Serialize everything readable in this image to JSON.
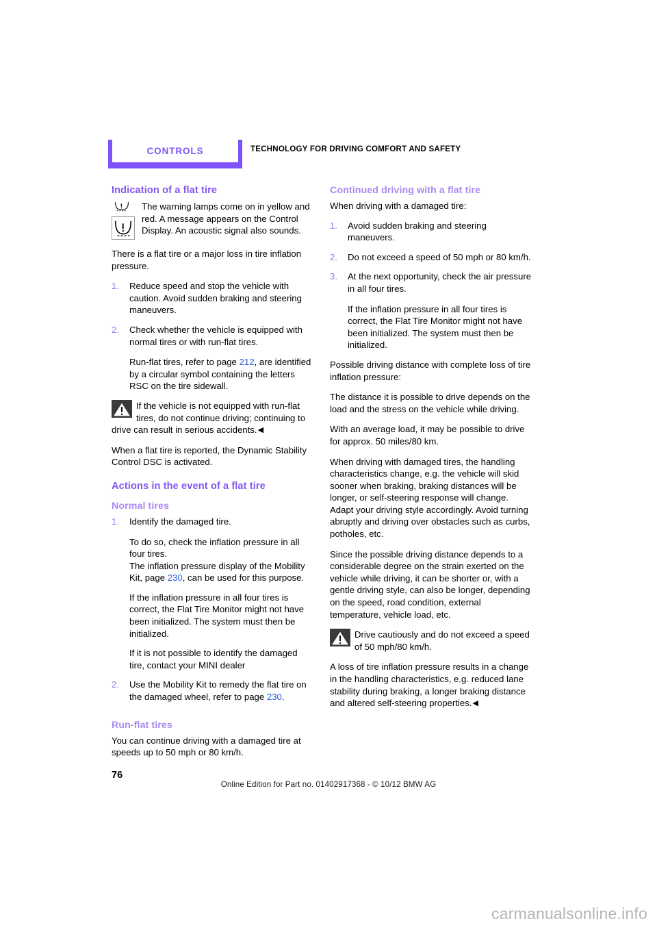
{
  "header": {
    "tab_label": "CONTROLS",
    "section_title": "TECHNOLOGY FOR DRIVING COMFORT AND SAFETY"
  },
  "colors": {
    "accent_purple": "#7d53f7",
    "heading_purple": "#8456f0",
    "subheading_purple": "#a98af2",
    "list_number_purple": "#9b7af0",
    "page_ref_blue": "#2a5bd7",
    "watermark_gray": "#b4b4b4"
  },
  "left_column": {
    "heading_1": "Indication of a flat tire",
    "warning_lamp_text": "The warning lamps come on in yellow and red. A message appears on the Control Display. An acoustic signal also sounds.",
    "para_flat_tire": "There is a flat tire or a major loss in tire inflation pressure.",
    "list_1": [
      {
        "num": "1.",
        "text": "Reduce speed and stop the vehicle with caution. Avoid sudden braking and steering maneuvers."
      },
      {
        "num": "2.",
        "text": "Check whether the vehicle is equipped with normal tires or with run-flat tires."
      }
    ],
    "runflat_note_a": "Run-flat tires, refer to page ",
    "runflat_note_ref": "212",
    "runflat_note_b": ", are identified by a circular symbol containing the letters RSC on the tire sidewall.",
    "warning_1": "If the vehicle is not equipped with run-flat tires, do not continue driving; continuing to drive can result in serious accidents.",
    "para_dsc": "When a flat tire is reported, the Dynamic Stability Control DSC is activated.",
    "heading_2": "Actions in the event of a flat tire",
    "subheading_normal": "Normal tires",
    "list_2": [
      {
        "num": "1.",
        "text": "Identify the damaged tire."
      }
    ],
    "sub_check_pressure": "To do so, check the inflation pressure in all four tires.",
    "sub_mobility_a": "The inflation pressure display of the Mobility Kit, page ",
    "sub_mobility_ref": "230",
    "sub_mobility_b": ", can be used for this purpose.",
    "sub_initialize": "If the inflation pressure in all four tires is correct, the Flat Tire Monitor might not have been initialized. The system must then be initialized.",
    "sub_dealer": "If it is not possible to identify the damaged tire, contact your MINI dealer",
    "list_2b": [
      {
        "num": "2.",
        "text_a": "Use the Mobility Kit to remedy the flat tire on the damaged wheel, refer to page ",
        "ref": "230",
        "text_b": "."
      }
    ],
    "subheading_runflat": "Run-flat tires",
    "para_runflat": "You can continue driving with a damaged tire at speeds up to 50 mph or 80 km/h."
  },
  "right_column": {
    "subheading_continued": "Continued driving with a flat tire",
    "para_when_driving": "When driving with a damaged tire:",
    "list_1": [
      {
        "num": "1.",
        "text": "Avoid sudden braking and steering maneuvers."
      },
      {
        "num": "2.",
        "text": "Do not exceed a speed of 50 mph or 80 km/h."
      },
      {
        "num": "3.",
        "text": "At the next opportunity, check the air pressure in all four tires."
      }
    ],
    "sub_initialize": "If the inflation pressure in all four tires is correct, the Flat Tire Monitor might not have been initialized. The system must then be initialized.",
    "para_possible_distance": "Possible driving distance with complete loss of tire inflation pressure:",
    "para_distance_depends": "The distance it is possible to drive depends on the load and the stress on the vehicle while driving.",
    "para_average_load": "With an average load, it may be possible to drive for approx. 50 miles/80 km.",
    "para_handling": "When driving with damaged tires, the handling characteristics change, e.g. the vehicle will skid sooner when braking, braking distances will be longer, or self-steering response will change. Adapt your driving style accordingly. Avoid turning abruptly and driving over obstacles such as curbs, potholes, etc.",
    "para_since": "Since the possible driving distance depends to a considerable degree on the strain exerted on the vehicle while driving, it can be shorter or, with a gentle driving style, can also be longer, depending on the speed, road condition, external temperature, vehicle load, etc.",
    "warning_2": "Drive cautiously and do not exceed a speed of 50 mph/80 km/h.",
    "para_loss": "A loss of tire inflation pressure results in a change in the handling characteristics, e.g. reduced lane stability during braking, a longer braking distance and altered self-steering properties."
  },
  "footer": {
    "page_number": "76",
    "note": "Online Edition for Part no. 01402917368 - © 10/12 BMW AG"
  },
  "watermark": {
    "text": "carmanualsonline.info"
  },
  "icons": {
    "tire_pressure_small": "tire-pressure-warning-icon",
    "tire_pressure_boxed": "tire-pressure-warning-boxed-icon",
    "warning_triangle": "warning-triangle-icon",
    "end_marker": "◀"
  }
}
